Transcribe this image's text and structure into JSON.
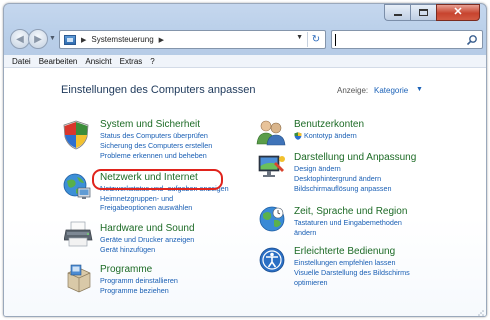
{
  "window": {
    "buttons": {
      "minimize": "",
      "maximize": "",
      "close": "✕"
    }
  },
  "nav": {
    "back_glyph": "◀",
    "forward_glyph": "▶",
    "address": {
      "arrow": "▶",
      "location": "Systemsteuerung",
      "trailing_arrow": "▶"
    },
    "refresh_glyph": "↻",
    "search_placeholder": ""
  },
  "menubar": {
    "items": [
      "Datei",
      "Bearbeiten",
      "Ansicht",
      "Extras",
      "?"
    ]
  },
  "content": {
    "title": "Einstellungen des Computers anpassen",
    "view_label": "Anzeige:",
    "view_value": "Kategorie",
    "view_arrow": "▼",
    "left_categories": [
      {
        "title": "System und Sicherheit",
        "icon": "shield-icon",
        "links": [
          "Status des Computers überprüfen",
          "Sicherung des Computers erstellen",
          "Probleme erkennen und beheben"
        ]
      },
      {
        "title": "Netzwerk und Internet",
        "icon": "network-globe-icon",
        "links": [
          "Netzwerkstatus und -aufgaben anzeigen",
          "Heimnetzgruppen- und",
          "Freigabeoptionen auswählen"
        ]
      },
      {
        "title": "Hardware und Sound",
        "icon": "printer-icon",
        "links": [
          "Geräte und Drucker anzeigen",
          "Gerät hinzufügen"
        ]
      },
      {
        "title": "Programme",
        "icon": "programs-box-icon",
        "links": [
          "Programm deinstallieren",
          "Programme beziehen"
        ]
      }
    ],
    "right_categories": [
      {
        "title": "Benutzerkonten",
        "icon": "users-icon",
        "links": [
          "Kontotyp ändern"
        ]
      },
      {
        "title": "Darstellung und Anpassung",
        "icon": "display-icon",
        "links": [
          "Design ändern",
          "Desktophintergrund ändern",
          "Bildschirmauflösung anpassen"
        ]
      },
      {
        "title": "Zeit, Sprache und Region",
        "icon": "globe-clock-icon",
        "links": [
          "Tastaturen und Eingabemethoden",
          "ändern"
        ]
      },
      {
        "title": "Erleichterte Bedienung",
        "icon": "accessibility-icon",
        "links": [
          "Einstellungen empfehlen lassen",
          "Visuelle Darstellung des Bildschirms",
          "optimieren"
        ]
      }
    ]
  },
  "colors": {
    "category_title": "#1d6b26",
    "link": "#1a5fb4",
    "highlight": "#e0231c",
    "title": "#1e395b"
  }
}
